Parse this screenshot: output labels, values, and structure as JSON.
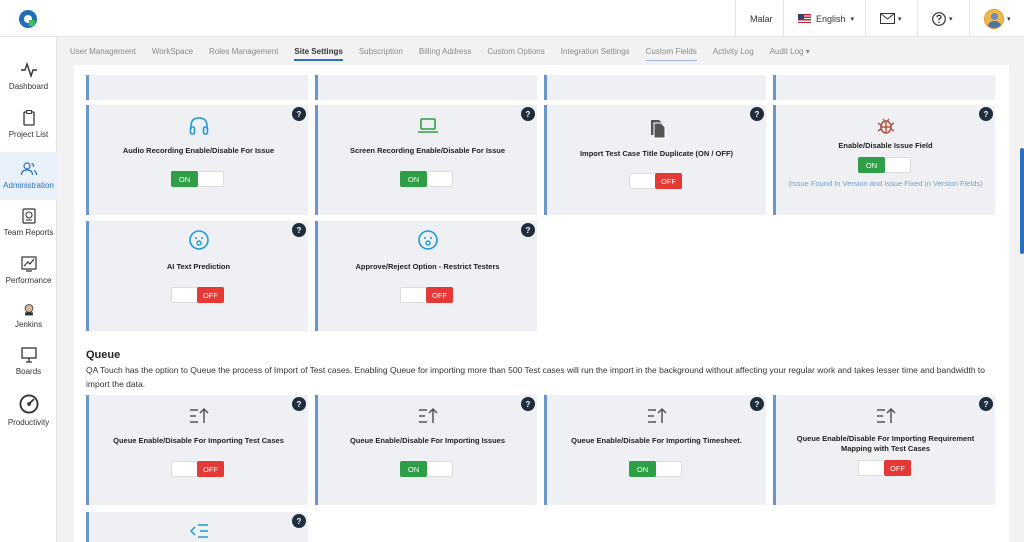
{
  "topbar": {
    "user_name": "Malar",
    "language": "English"
  },
  "sidebar": {
    "items": [
      {
        "label": "Dashboard"
      },
      {
        "label": "Project List"
      },
      {
        "label": "Administration"
      },
      {
        "label": "Team Reports"
      },
      {
        "label": "Performance"
      },
      {
        "label": "Jenkins"
      },
      {
        "label": "Boards"
      },
      {
        "label": "Productivity"
      }
    ]
  },
  "tabs": [
    {
      "label": "User Management"
    },
    {
      "label": "WorkSpace"
    },
    {
      "label": "Roles Management"
    },
    {
      "label": "Site Settings"
    },
    {
      "label": "Subscription"
    },
    {
      "label": "Billing Address"
    },
    {
      "label": "Custom Options"
    },
    {
      "label": "Integration Settings"
    },
    {
      "label": "Custom Fields"
    },
    {
      "label": "Activity Log"
    },
    {
      "label": "Audit Log ▾"
    }
  ],
  "help_label": "?",
  "settings": [
    {
      "title": "Audio Recording Enable/Disable For Issue",
      "state": "ON"
    },
    {
      "title": "Screen Recording Enable/Disable For Issue",
      "state": "ON"
    },
    {
      "title": "Import Test Case Title Duplicate (ON / OFF)",
      "state": "OFF"
    },
    {
      "title": "Enable/Disable Issue Field",
      "state": "ON",
      "note": "(Issue Found In Version and Issue Fixed In Version Fields)"
    },
    {
      "title": "AI Text Prediction",
      "state": "OFF"
    },
    {
      "title": "Approve/Reject Option - Restrict Testers",
      "state": "OFF"
    }
  ],
  "queue": {
    "heading": "Queue",
    "description": "QA Touch has the option to Queue the process of Import of Test cases. Enabling Queue for importing more than 500 Test cases will run the import in the background without affecting your regular work and takes lesser time and bandwidth to import the data.",
    "items": [
      {
        "title": "Queue Enable/Disable For Importing Test Cases",
        "state": "OFF"
      },
      {
        "title": "Queue Enable/Disable For Importing Issues",
        "state": "ON"
      },
      {
        "title": "Queue Enable/Disable For Importing Timesheet.",
        "state": "ON"
      },
      {
        "title": "Queue Enable/Disable For Importing Requirement Mapping with Test Cases",
        "state": "OFF"
      }
    ]
  },
  "colors": {
    "accent": "#2a6fc0",
    "on": "#2e9e47",
    "off": "#e53935",
    "icon_blue": "#1e9bd7",
    "icon_green": "#2e9e47"
  }
}
